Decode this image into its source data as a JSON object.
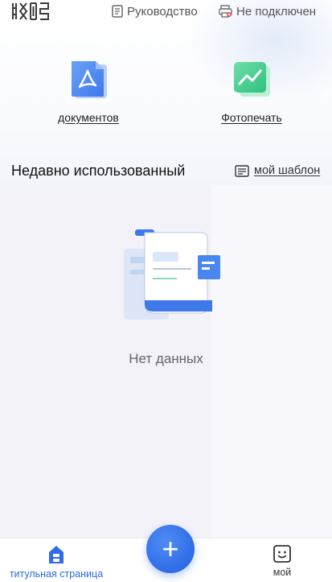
{
  "topbar": {
    "guide_label": "Руководство",
    "printer_status_label": "Не подключен"
  },
  "features": {
    "docs_label": "документов",
    "photo_label": "Фотопечать"
  },
  "recent": {
    "title": "Недавно использованный",
    "template_link_label": "мой шаблон",
    "empty_text": "Нет данных"
  },
  "bottom_nav": {
    "home_label": "титульная страница",
    "add_symbol": "+",
    "mine_label": "мой"
  },
  "colors": {
    "accent": "#2f6ce6",
    "pdf_icon": "#4a86f0",
    "photo_icon": "#3ecf8e"
  },
  "icons": {
    "logo": "app-logo",
    "guide": "document-icon",
    "printer": "printer-disconnected-icon",
    "docs": "pdf-icon",
    "photo": "photo-chart-icon",
    "template": "template-list-icon",
    "home": "home-icon",
    "add": "plus-icon",
    "mine": "smile-face-icon"
  }
}
